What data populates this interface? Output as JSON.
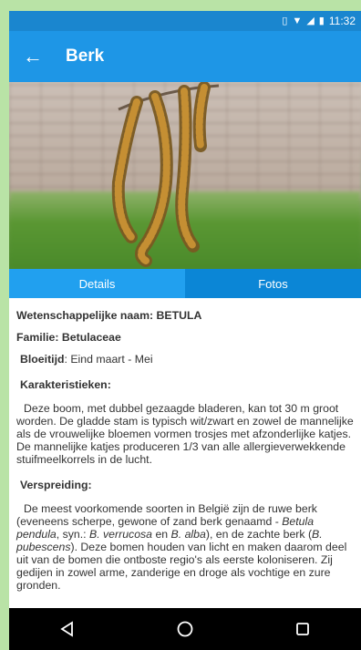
{
  "statusbar": {
    "time": "11:32"
  },
  "appbar": {
    "title": "Berk"
  },
  "tabs": [
    {
      "label": "Details",
      "active": true
    },
    {
      "label": "Fotos",
      "active": false
    }
  ],
  "details": {
    "sci_name": "Wetenschappelijke naam: BETULA",
    "family": "Familie: Betulaceae",
    "flowering_label": "Bloeitijd",
    "flowering_value": ": Eind maart - Mei",
    "characteristics_heading": "Karakteristieken:",
    "characteristics_text": "Deze boom, met dubbel gezaagde bladeren, kan tot 30 m groot worden. De gladde stam is typisch wit/zwart en zowel de mannelijke als de vrouwelijke bloemen vormen trosjes met afzonderlijke katjes. De mannelijke katjes produceren 1/3 van alle allergieverwekkende stuifmeelkorrels in de lucht.",
    "distribution_heading": "Verspreiding:",
    "dist_1": "De meest voorkomende soorten in België zijn de ruwe berk (eveneens scherpe, gewone of zand berk genaamd - ",
    "dist_2": "Betula pendula",
    "dist_3": ", syn.: ",
    "dist_4": "B. verrucosa",
    "dist_5": " en ",
    "dist_6": "B. alba",
    "dist_7": "),  en de zachte berk (",
    "dist_8": "B. pubescens",
    "dist_9": "). Deze bomen houden van licht en maken daarom deel uit van de bomen die ontboste regio's als eerste koloniseren. Zij gedijen in zowel arme, zanderige en droge als vochtige en zure gronden."
  },
  "colors": {
    "statusbar": "#1a86cf",
    "appbar": "#1e96e6",
    "tab_active": "#21a0ef",
    "tab_inactive": "#0b86d6"
  }
}
